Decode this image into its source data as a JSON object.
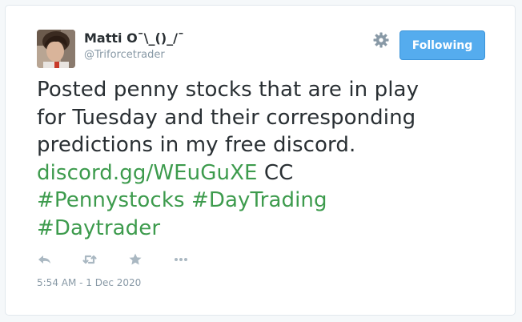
{
  "user": {
    "display_name": "Matti O¯\\_()_/¯",
    "handle": "@Triforcetrader",
    "avatar_icon": "user-avatar"
  },
  "header": {
    "settings_icon": "gear-icon",
    "follow_label": "Following"
  },
  "tweet": {
    "text_line1": "Posted penny stocks that are in play",
    "text_line2": "for Tuesday and their corresponding",
    "text_line3": "predictions in my free discord.",
    "link_url": "discord.gg/WEuGuXE",
    "text_after_link": " CC",
    "hashtags": [
      "#Pennystocks",
      "#DayTrading",
      "#Daytrader"
    ]
  },
  "actions": {
    "icons": [
      "reply-icon",
      "retweet-icon",
      "like-icon",
      "more-icon"
    ]
  },
  "timestamp": "5:54 AM - 1 Dec 2020",
  "colors": {
    "link": "#3d9b4d",
    "button": "#55acee",
    "muted": "#8899a6",
    "text": "#292f33"
  }
}
